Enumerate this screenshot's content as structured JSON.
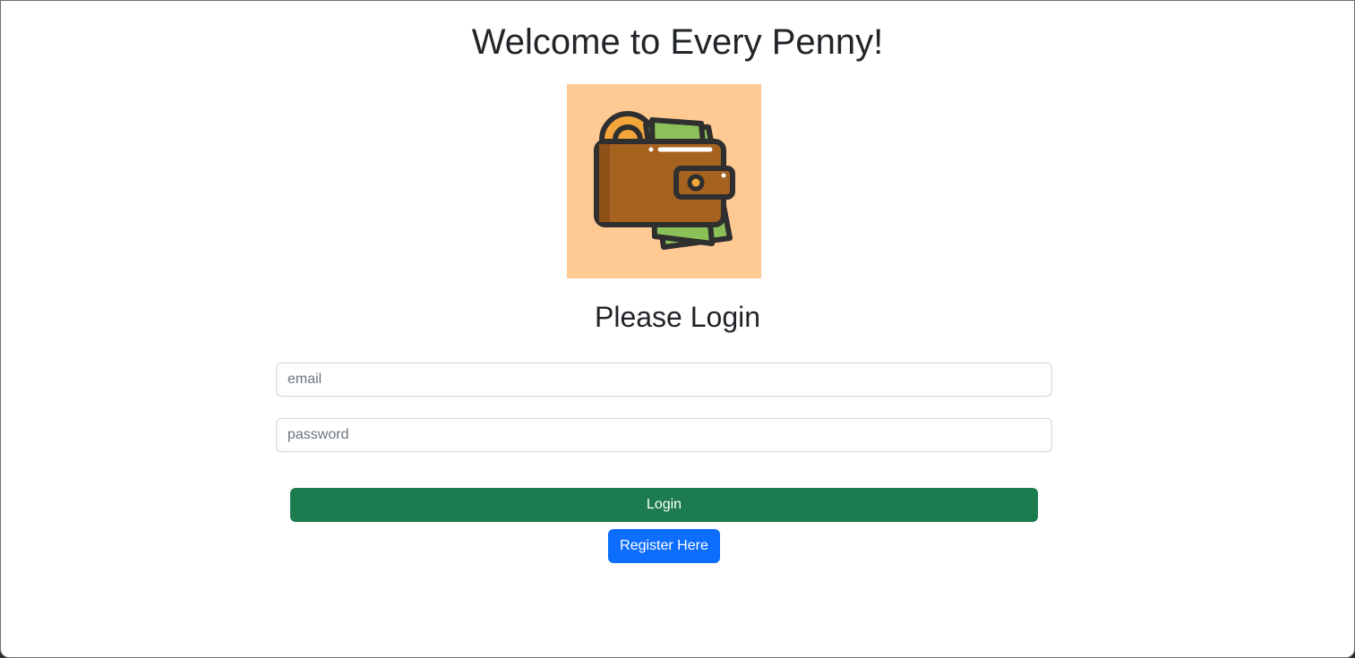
{
  "page": {
    "heading": "Welcome to Every Penny!",
    "logo_icon": "wallet-icon",
    "subheading": "Please Login"
  },
  "form": {
    "email_placeholder": "email",
    "email_value": "",
    "password_placeholder": "password",
    "password_value": "",
    "login_label": "Login",
    "register_label": "Register Here"
  },
  "colors": {
    "logo_background": "#ffc994",
    "login_button": "#1c7c4f",
    "register_button": "#0d6efd",
    "wallet": "#a6621f",
    "cash": "#8cc15a",
    "coin": "#f3a73b"
  }
}
